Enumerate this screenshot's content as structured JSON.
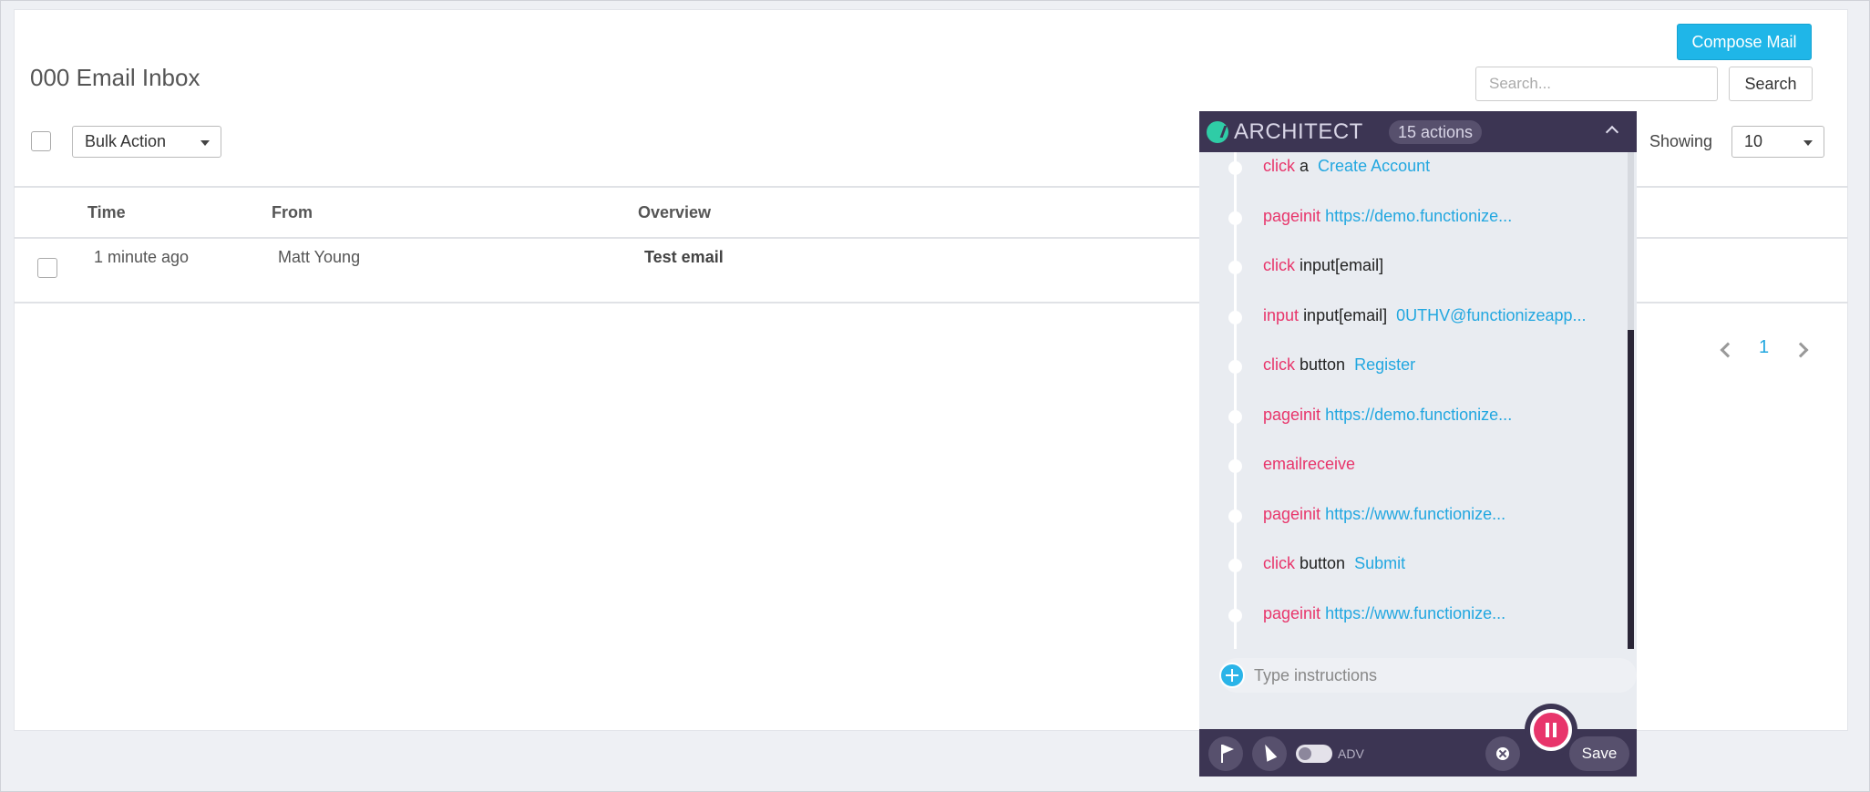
{
  "inbox": {
    "title": "000 Email Inbox",
    "compose_label": "Compose Mail",
    "search_placeholder": "Search...",
    "search_label": "Search",
    "bulk_action": "Bulk Action",
    "showing_label": "Showing",
    "showing_value": "10",
    "columns": [
      "Time",
      "From",
      "Overview"
    ],
    "rows": [
      {
        "time": "1 minute ago",
        "from": "Matt Young",
        "overview": "Test email"
      }
    ],
    "page": "1"
  },
  "architect": {
    "title": "ARCHITECT",
    "count": "15 actions",
    "actions": [
      {
        "kw": "click",
        "target": "a",
        "value": "Create Account"
      },
      {
        "kw": "pageinit",
        "target": "",
        "value": "https://demo.functionize..."
      },
      {
        "kw": "click",
        "target": "input[email]",
        "value": ""
      },
      {
        "kw": "input",
        "target": "input[email]",
        "value": "0UTHV@functionizeapp..."
      },
      {
        "kw": "click",
        "target": "button",
        "value": "Register"
      },
      {
        "kw": "pageinit",
        "target": "",
        "value": "https://demo.functionize..."
      },
      {
        "kw": "emailreceive",
        "target": "",
        "value": ""
      },
      {
        "kw": "pageinit",
        "target": "",
        "value": "https://www.functionize..."
      },
      {
        "kw": "click",
        "target": "button",
        "value": "Submit"
      },
      {
        "kw": "pageinit",
        "target": "",
        "value": "https://www.functionize..."
      }
    ],
    "instructions_placeholder": "Type instructions",
    "adv_label": "ADV",
    "save_label": "Save",
    "colors": {
      "header": "#3c3553",
      "keyword": "#e8356b",
      "value": "#22a7e0",
      "record": "#e8356b"
    }
  }
}
